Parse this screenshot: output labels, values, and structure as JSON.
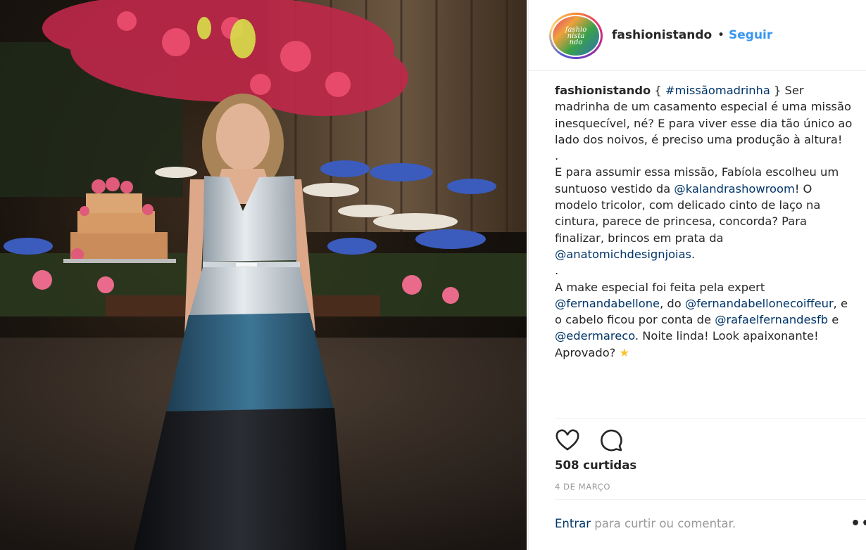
{
  "post": {
    "image_alt": "Foto de uma mulher em vestido tricolor em festa de casamento",
    "username": "fashionistando",
    "separator": "•",
    "follow_label": "Seguir",
    "avatar_text": "fashio\nnista\nndo"
  },
  "caption": {
    "owner": "fashionistando",
    "line1_pre": " { ",
    "hashtag": "#missãomadrinha",
    "line1_post": " } Ser madrinha de um casamento especial é uma missão inesquecível, né? E para viver esse dia tão único ao lado dos noivos, é preciso uma produção à altura!",
    "dot1": ".",
    "p2_pre": "E para assumir essa missão, Fabíola escolheu um suntuoso vestido da ",
    "mention_kalandra": "@kalandrashowroom",
    "p2_mid": "! O modelo tricolor, com delicado cinto de laço na cintura, parece de princesa, concorda? Para finalizar, brincos em prata da ",
    "mention_anatomich": "@anatomichdesignjoias",
    "p2_end": ".",
    "dot2": ".",
    "p3_pre": "A make especial foi feita pela expert ",
    "mention_fernanda": "@fernandabellone",
    "p3_a": ", do ",
    "mention_coiffeur": "@fernandabellonecoiffeur",
    "p3_b": ", e o cabelo ficou por conta de ",
    "mention_rafael": "@rafaelfernandesfb",
    "p3_c": " e ",
    "mention_eder": "@edermareco",
    "p3_d": ". Noite linda! Look apaixonante! Aprovado? ",
    "star": "★"
  },
  "actions": {
    "like_icon": "heart-icon",
    "comment_icon": "comment-icon"
  },
  "likes_text": "508 curtidas",
  "date_text": "4 DE MARÇO",
  "login": {
    "link_label": "Entrar",
    "rest": " para curtir ou comentar.",
    "more_label": "•••"
  },
  "colors": {
    "link_blue": "#003569",
    "follow_blue": "#3897f0",
    "muted": "#999999",
    "text": "#262626"
  }
}
